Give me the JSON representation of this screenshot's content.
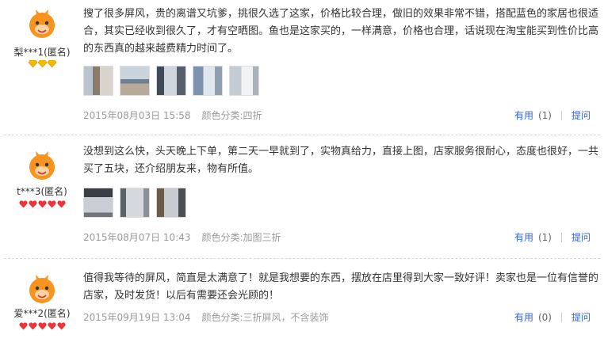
{
  "reviews": [
    {
      "username": "梨***1(匿名)",
      "level": "diamond-icon",
      "level_count": 3,
      "level_color": "#f5b800",
      "content": "搜了很多屏风，贵的离谱又坑爹，挑很久选了这家，价格比较合理，做旧的效果非常不错，搭配蓝色的家居也很适合，其实已经收到很久了，才有空晒图。鱼也是这家买的，一样满意，价格也合理，话说现在淘宝能买到性价比高的东西真的越来越费精力时间了。",
      "photos": [
        "photo-1",
        "photo-2",
        "photo-3",
        "photo-4",
        "photo-5"
      ],
      "date": "2015年08月03日 15:58",
      "sku": "颜色分类:四折",
      "useful_label": "有用",
      "useful_count": "(1)",
      "reply_label": "提问"
    },
    {
      "username": "t***3(匿名)",
      "level": "heart-icon",
      "level_count": 5,
      "level_color": "#e8363b",
      "content": "没想到这么快，头天晚上下单，第二天一早就到了，实物真给力，直接上图，店家服务很耐心，态度也很好，一共买了五块，还介绍朋友来，物有所值。",
      "photos": [
        "photo-1",
        "photo-2",
        "photo-3"
      ],
      "date": "2015年08月07日 10:43",
      "sku": "颜色分类:加图三折",
      "useful_label": "有用",
      "useful_count": "(1)",
      "reply_label": "提问"
    },
    {
      "username": "爱***2(匿名)",
      "level": "heart-icon",
      "level_count": 5,
      "level_color": "#e8363b",
      "content": "值得我等待的屏风，简直是太满意了！就是我想要的东西，摆放在店里得到大家一致好评！卖家也是一位有信誉的店家，及时发货！以后有需要还会光顾的！",
      "photos": [],
      "date": "2015年09月19日 13:04",
      "sku": "颜色分类:三折屏风，不含装饰",
      "useful_label": "有用",
      "useful_count": "(0)",
      "reply_label": "提问"
    }
  ],
  "colors": {
    "avatar": "#f7931e",
    "link": "#3366cc",
    "muted": "#999999"
  }
}
